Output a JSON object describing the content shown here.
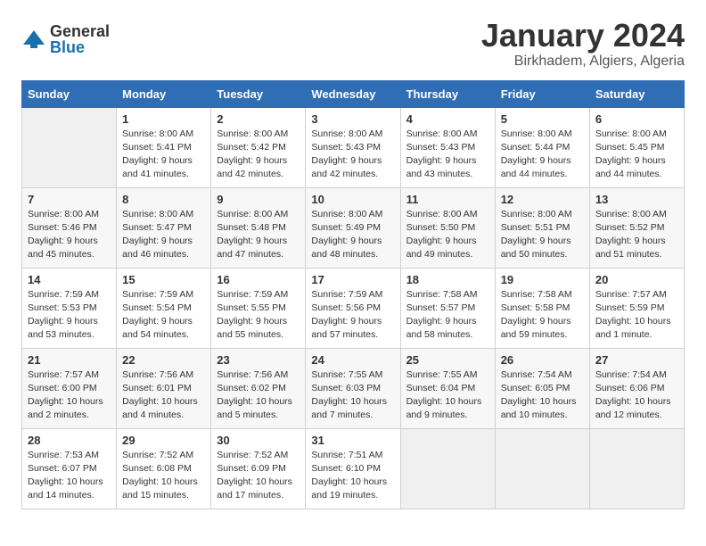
{
  "logo": {
    "general": "General",
    "blue": "Blue"
  },
  "title": "January 2024",
  "location": "Birkhadem, Algiers, Algeria",
  "days_of_week": [
    "Sunday",
    "Monday",
    "Tuesday",
    "Wednesday",
    "Thursday",
    "Friday",
    "Saturday"
  ],
  "weeks": [
    [
      {
        "day": "",
        "info": ""
      },
      {
        "day": "1",
        "info": "Sunrise: 8:00 AM\nSunset: 5:41 PM\nDaylight: 9 hours\nand 41 minutes."
      },
      {
        "day": "2",
        "info": "Sunrise: 8:00 AM\nSunset: 5:42 PM\nDaylight: 9 hours\nand 42 minutes."
      },
      {
        "day": "3",
        "info": "Sunrise: 8:00 AM\nSunset: 5:43 PM\nDaylight: 9 hours\nand 42 minutes."
      },
      {
        "day": "4",
        "info": "Sunrise: 8:00 AM\nSunset: 5:43 PM\nDaylight: 9 hours\nand 43 minutes."
      },
      {
        "day": "5",
        "info": "Sunrise: 8:00 AM\nSunset: 5:44 PM\nDaylight: 9 hours\nand 44 minutes."
      },
      {
        "day": "6",
        "info": "Sunrise: 8:00 AM\nSunset: 5:45 PM\nDaylight: 9 hours\nand 44 minutes."
      }
    ],
    [
      {
        "day": "7",
        "info": "Sunrise: 8:00 AM\nSunset: 5:46 PM\nDaylight: 9 hours\nand 45 minutes."
      },
      {
        "day": "8",
        "info": "Sunrise: 8:00 AM\nSunset: 5:47 PM\nDaylight: 9 hours\nand 46 minutes."
      },
      {
        "day": "9",
        "info": "Sunrise: 8:00 AM\nSunset: 5:48 PM\nDaylight: 9 hours\nand 47 minutes."
      },
      {
        "day": "10",
        "info": "Sunrise: 8:00 AM\nSunset: 5:49 PM\nDaylight: 9 hours\nand 48 minutes."
      },
      {
        "day": "11",
        "info": "Sunrise: 8:00 AM\nSunset: 5:50 PM\nDaylight: 9 hours\nand 49 minutes."
      },
      {
        "day": "12",
        "info": "Sunrise: 8:00 AM\nSunset: 5:51 PM\nDaylight: 9 hours\nand 50 minutes."
      },
      {
        "day": "13",
        "info": "Sunrise: 8:00 AM\nSunset: 5:52 PM\nDaylight: 9 hours\nand 51 minutes."
      }
    ],
    [
      {
        "day": "14",
        "info": "Sunrise: 7:59 AM\nSunset: 5:53 PM\nDaylight: 9 hours\nand 53 minutes."
      },
      {
        "day": "15",
        "info": "Sunrise: 7:59 AM\nSunset: 5:54 PM\nDaylight: 9 hours\nand 54 minutes."
      },
      {
        "day": "16",
        "info": "Sunrise: 7:59 AM\nSunset: 5:55 PM\nDaylight: 9 hours\nand 55 minutes."
      },
      {
        "day": "17",
        "info": "Sunrise: 7:59 AM\nSunset: 5:56 PM\nDaylight: 9 hours\nand 57 minutes."
      },
      {
        "day": "18",
        "info": "Sunrise: 7:58 AM\nSunset: 5:57 PM\nDaylight: 9 hours\nand 58 minutes."
      },
      {
        "day": "19",
        "info": "Sunrise: 7:58 AM\nSunset: 5:58 PM\nDaylight: 9 hours\nand 59 minutes."
      },
      {
        "day": "20",
        "info": "Sunrise: 7:57 AM\nSunset: 5:59 PM\nDaylight: 10 hours\nand 1 minute."
      }
    ],
    [
      {
        "day": "21",
        "info": "Sunrise: 7:57 AM\nSunset: 6:00 PM\nDaylight: 10 hours\nand 2 minutes."
      },
      {
        "day": "22",
        "info": "Sunrise: 7:56 AM\nSunset: 6:01 PM\nDaylight: 10 hours\nand 4 minutes."
      },
      {
        "day": "23",
        "info": "Sunrise: 7:56 AM\nSunset: 6:02 PM\nDaylight: 10 hours\nand 5 minutes."
      },
      {
        "day": "24",
        "info": "Sunrise: 7:55 AM\nSunset: 6:03 PM\nDaylight: 10 hours\nand 7 minutes."
      },
      {
        "day": "25",
        "info": "Sunrise: 7:55 AM\nSunset: 6:04 PM\nDaylight: 10 hours\nand 9 minutes."
      },
      {
        "day": "26",
        "info": "Sunrise: 7:54 AM\nSunset: 6:05 PM\nDaylight: 10 hours\nand 10 minutes."
      },
      {
        "day": "27",
        "info": "Sunrise: 7:54 AM\nSunset: 6:06 PM\nDaylight: 10 hours\nand 12 minutes."
      }
    ],
    [
      {
        "day": "28",
        "info": "Sunrise: 7:53 AM\nSunset: 6:07 PM\nDaylight: 10 hours\nand 14 minutes."
      },
      {
        "day": "29",
        "info": "Sunrise: 7:52 AM\nSunset: 6:08 PM\nDaylight: 10 hours\nand 15 minutes."
      },
      {
        "day": "30",
        "info": "Sunrise: 7:52 AM\nSunset: 6:09 PM\nDaylight: 10 hours\nand 17 minutes."
      },
      {
        "day": "31",
        "info": "Sunrise: 7:51 AM\nSunset: 6:10 PM\nDaylight: 10 hours\nand 19 minutes."
      },
      {
        "day": "",
        "info": ""
      },
      {
        "day": "",
        "info": ""
      },
      {
        "day": "",
        "info": ""
      }
    ]
  ]
}
